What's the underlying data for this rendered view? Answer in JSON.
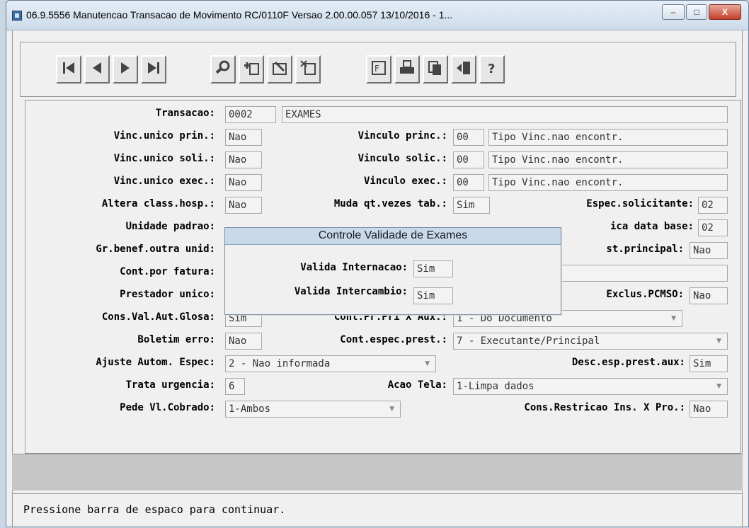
{
  "window": {
    "title": "06.9.5556 Manutencao  Transacao de Movimento RC/0110F Versao 2.00.00.057 13/10/2016 - 1...",
    "minimize": "–",
    "maximize": "□",
    "close": "X"
  },
  "toolbar": {
    "icons": [
      "first-record-icon",
      "previous-record-icon",
      "next-record-icon",
      "last-record-icon",
      "search-icon",
      "add-icon",
      "edit-icon",
      "delete-icon",
      "filter-icon",
      "print-icon",
      "copy-icon",
      "exit-icon",
      "help-icon"
    ]
  },
  "form": {
    "transacao_label": "Transacao:",
    "transacao_code": "0002",
    "transacao_desc": "EXAMES",
    "vinc_unico_prin_label": "Vinc.unico prin.:",
    "vinc_unico_prin": "Nao",
    "vinculo_princ_label": "Vinculo princ.:",
    "vinculo_princ_code": "00",
    "vinculo_princ_desc": "Tipo Vinc.nao encontr.",
    "vinc_unico_soli_label": "Vinc.unico soli.:",
    "vinc_unico_soli": "Nao",
    "vinculo_solic_label": "Vinculo solic.:",
    "vinculo_solic_code": "00",
    "vinculo_solic_desc": "Tipo Vinc.nao encontr.",
    "vinc_unico_exec_label": "Vinc.unico exec.:",
    "vinc_unico_exec": "Nao",
    "vinculo_exec_label": "Vinculo exec.:",
    "vinculo_exec_code": "00",
    "vinculo_exec_desc": "Tipo Vinc.nao encontr.",
    "altera_class_label": "Altera class.hosp.:",
    "altera_class": "Nao",
    "muda_qt_label": "Muda qt.vezes tab.:",
    "muda_qt": "Sim",
    "espec_solic_label": "Espec.solicitante:",
    "espec_solic": "02",
    "unidade_padrao_label": "Unidade padrao:",
    "ica_data_base_label": "ica data base:",
    "ica_data_base": "02",
    "gr_benef_label": "Gr.benef.outra unid:",
    "st_principal_label": "st.principal:",
    "st_principal": "Nao",
    "cont_por_fatura_label": "Cont.por fatura:",
    "prestador_unico_label": "Prestador unico:",
    "exclus_pcmso_label": "Exclus.PCMSO:",
    "exclus_pcmso": "Nao",
    "cons_val_label": "Cons.Val.Aut.Glosa:",
    "cons_val": "Sim",
    "cont_pr_pri_label": "Cont.Pr.Pri X Aux.:",
    "cont_pr_pri": "1 - Do Documento",
    "boletim_erro_label": "Boletim erro:",
    "boletim_erro": "Nao",
    "cont_espec_label": "Cont.espec.prest.:",
    "cont_espec": "7 - Executante/Principal",
    "ajuste_label": "Ajuste Autom. Espec:",
    "ajuste": "2 - Nao informada",
    "desc_esp_label": "Desc.esp.prest.aux:",
    "desc_esp": "Sim",
    "trata_urgencia_label": "Trata urgencia:",
    "trata_urgencia": "6",
    "acao_tela_label": "Acao Tela:",
    "acao_tela": "1-Limpa dados",
    "pede_vl_label": "Pede Vl.Cobrado:",
    "pede_vl": "1-Ambos",
    "cons_restricao_label": "Cons.Restricao Ins. X Pro.:",
    "cons_restricao": "Nao"
  },
  "popup": {
    "title": "Controle Validade de Exames",
    "valida_internacao_label": "Valida Internacao:",
    "valida_internacao": "Sim",
    "valida_intercambio_label": "Valida Intercambio:",
    "valida_intercambio": "Sim"
  },
  "status": {
    "message": "Pressione barra de espaco para continuar."
  }
}
